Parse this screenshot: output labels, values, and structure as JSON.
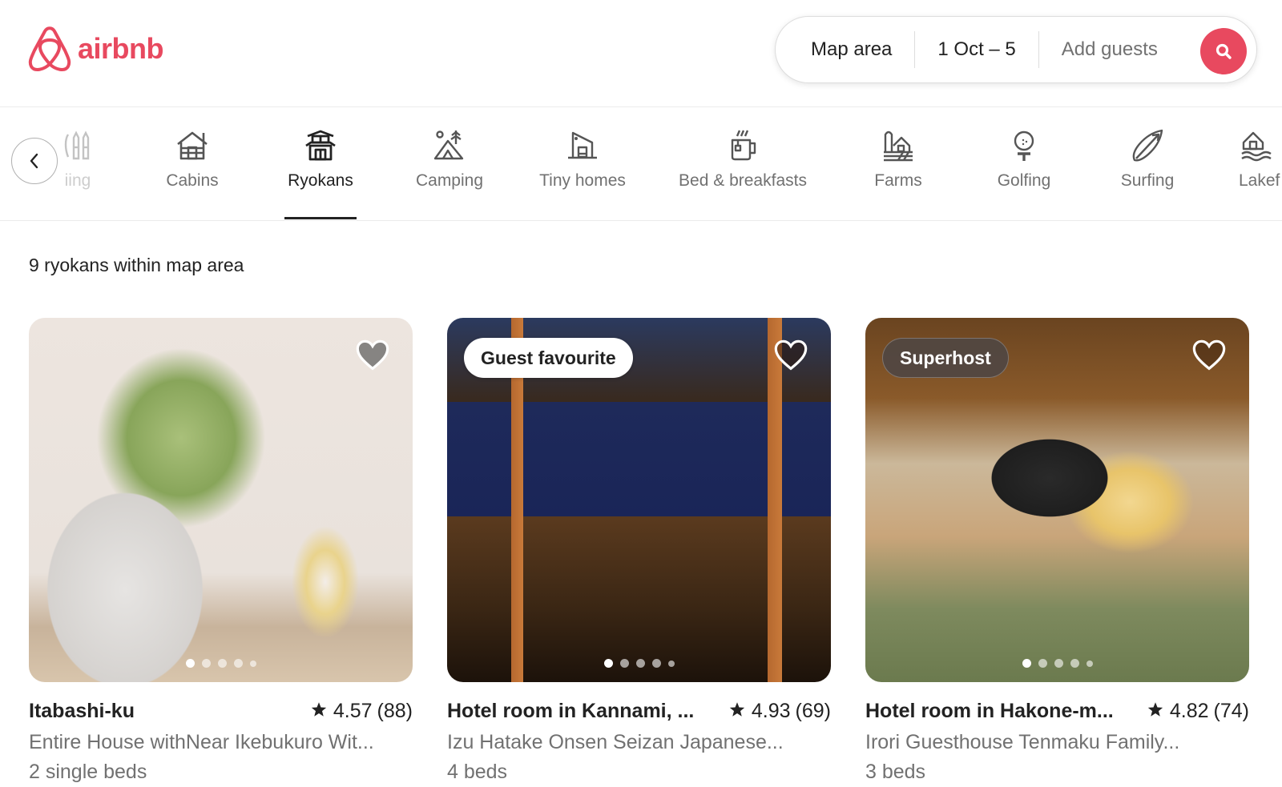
{
  "header": {
    "logo_text": "airbnb",
    "brand_color": "#e8495f",
    "search": {
      "location": "Map area",
      "dates": "1 Oct – 5",
      "guests_placeholder": "Add guests",
      "search_icon": "search-icon"
    }
  },
  "categories": {
    "back_icon": "chevron-left-icon",
    "items": [
      {
        "label": "Skiing",
        "visible_label": "iing",
        "icon": "skis-icon",
        "active": false
      },
      {
        "label": "Cabins",
        "icon": "cabin-icon",
        "active": false
      },
      {
        "label": "Ryokans",
        "icon": "ryokan-icon",
        "active": true
      },
      {
        "label": "Camping",
        "icon": "tent-icon",
        "active": false
      },
      {
        "label": "Tiny homes",
        "icon": "tiny-home-icon",
        "active": false
      },
      {
        "label": "Bed & breakfasts",
        "icon": "tea-mug-icon",
        "active": false
      },
      {
        "label": "Farms",
        "icon": "farm-icon",
        "active": false
      },
      {
        "label": "Golfing",
        "icon": "golf-ball-icon",
        "active": false
      },
      {
        "label": "Surfing",
        "icon": "surfboard-icon",
        "active": false
      },
      {
        "label": "Lakefront",
        "visible_label": "Lakef",
        "icon": "lakefront-icon",
        "active": false
      }
    ]
  },
  "results": {
    "title": "9 ryokans within map area",
    "listings": [
      {
        "badge": null,
        "name": "Itabashi-ku",
        "rating": "4.57",
        "reviews": "(88)",
        "description": "Entire House withNear Ikebukuro Wit...",
        "beds": "2 single beds",
        "photo_count": 5,
        "active_photo": 1,
        "favourited": false
      },
      {
        "badge": "Guest favourite",
        "name": "Hotel room in Kannami, ...",
        "rating": "4.93",
        "reviews": "(69)",
        "description": "Izu Hatake Onsen Seizan Japanese...",
        "beds": "4 beds",
        "photo_count": 5,
        "active_photo": 1,
        "favourited": false
      },
      {
        "badge": "Superhost",
        "name": "Hotel room in Hakone-m...",
        "rating": "4.82",
        "reviews": "(74)",
        "description": "Irori Guesthouse Tenmaku Family...",
        "beds": "3 beds",
        "photo_count": 5,
        "active_photo": 1,
        "favourited": false
      }
    ]
  }
}
